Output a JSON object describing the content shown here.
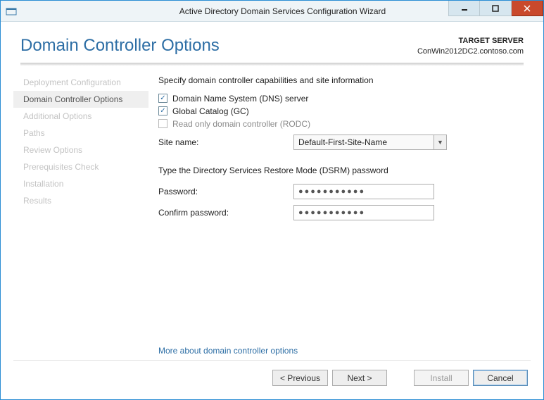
{
  "window": {
    "title": "Active Directory Domain Services Configuration Wizard"
  },
  "header": {
    "page_title": "Domain Controller Options",
    "target_label": "TARGET SERVER",
    "target_value": "ConWin2012DC2.contoso.com"
  },
  "nav": {
    "items": [
      "Deployment Configuration",
      "Domain Controller Options",
      "Additional Options",
      "Paths",
      "Review Options",
      "Prerequisites Check",
      "Installation",
      "Results"
    ],
    "active_index": 1
  },
  "content": {
    "caps_heading": "Specify domain controller capabilities and site information",
    "dns_label": "Domain Name System (DNS) server",
    "dns_checked": "✓",
    "gc_label": "Global Catalog (GC)",
    "gc_checked": "✓",
    "rodc_label": "Read only domain controller (RODC)",
    "rodc_checked": "",
    "site_label": "Site name:",
    "site_value": "Default-First-Site-Name",
    "dsrm_heading": "Type the Directory Services Restore Mode (DSRM) password",
    "password_label": "Password:",
    "password_value": "●●●●●●●●●●●",
    "confirm_label": "Confirm password:",
    "confirm_value": "●●●●●●●●●●●",
    "more_link": "More about domain controller options"
  },
  "footer": {
    "previous": "< Previous",
    "next": "Next >",
    "install": "Install",
    "cancel": "Cancel"
  }
}
